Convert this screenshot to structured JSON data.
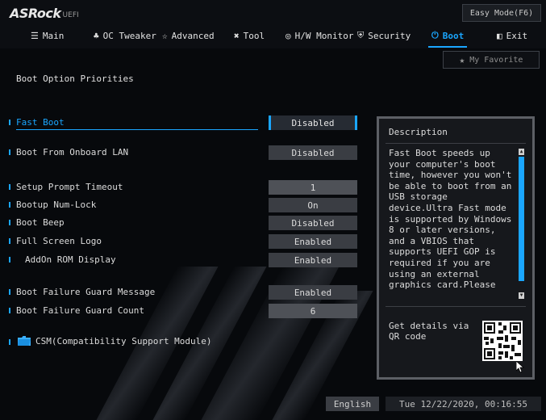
{
  "app": {
    "brand": "ASRock",
    "brand_suffix": "UEFI",
    "mode_button": "Easy Mode(F6)"
  },
  "menu": [
    {
      "label": "Main",
      "icon": "list-icon"
    },
    {
      "label": "OC Tweaker",
      "icon": "rocket-icon"
    },
    {
      "label": "Advanced",
      "icon": "star-icon"
    },
    {
      "label": "Tool",
      "icon": "tools-icon"
    },
    {
      "label": "H/W Monitor",
      "icon": "monitor-icon"
    },
    {
      "label": "Security",
      "icon": "shield-icon"
    },
    {
      "label": "Boot",
      "icon": "power-icon",
      "active": true
    },
    {
      "label": "Exit",
      "icon": "exit-icon"
    }
  ],
  "favorite": {
    "label": "My Favorite"
  },
  "page": {
    "title": "Boot Option Priorities"
  },
  "options": [
    {
      "label": "Fast Boot",
      "value": "Disabled"
    },
    {
      "label": "Boot From Onboard LAN",
      "value": "Disabled"
    },
    {
      "label": "Setup Prompt Timeout",
      "value": "1"
    },
    {
      "label": "Bootup Num-Lock",
      "value": "On"
    },
    {
      "label": "Boot Beep",
      "value": "Disabled"
    },
    {
      "label": "Full Screen Logo",
      "value": "Enabled"
    },
    {
      "label": "AddOn ROM Display",
      "value": "Enabled"
    },
    {
      "label": "Boot Failure Guard Message",
      "value": "Enabled"
    },
    {
      "label": "Boot Failure Guard Count",
      "value": "6"
    }
  ],
  "csm": {
    "label": "CSM(Compatibility Support Module)"
  },
  "description": {
    "title": "Description",
    "text": "Fast Boot speeds up your computer's boot time, however you won't be able to boot from an USB storage device.Ultra Fast mode is supported by Windows 8 or later versions, and a VBIOS that supports UEFI GOP is required if you are using an external graphics card.Please note that Ultra Fast mode boots so fast that",
    "qr_text": "Get details via QR code"
  },
  "status": {
    "language": "English",
    "datetime": "Tue 12/22/2020, 00:16:55"
  },
  "colors": {
    "accent": "#1aa6ff",
    "background": "#07090c",
    "value_bg": "#3a3d43"
  }
}
